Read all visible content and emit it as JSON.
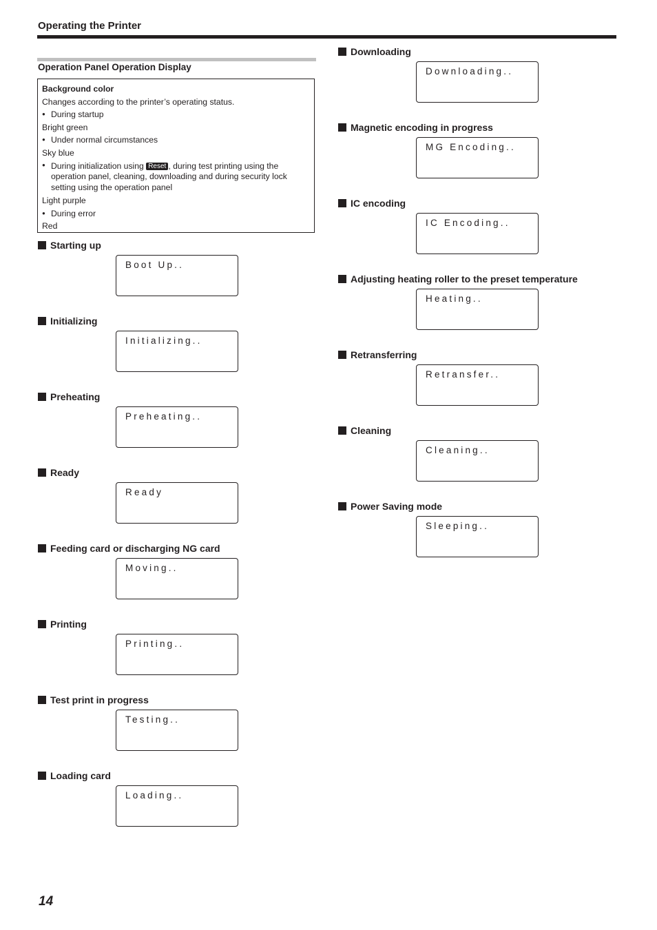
{
  "header": {
    "title": "Operating the Printer"
  },
  "section": {
    "title": "Operation Panel Operation Display"
  },
  "background_color_box": {
    "heading": "Background color",
    "intro": "Changes according to the printer’s operating status.",
    "entries": [
      {
        "condition": "During startup",
        "color": "Bright green"
      },
      {
        "condition": "Under normal circumstances",
        "color": "Sky blue"
      },
      {
        "condition_prefix": "During initialization using ",
        "key_label": "Reset",
        "condition_suffix": ", during test printing using the operation panel, cleaning, downloading and during security lock setting using the operation panel",
        "color": "Light purple"
      },
      {
        "condition": "During error",
        "color": "Red"
      }
    ]
  },
  "left_column": [
    {
      "heading": "Starting up",
      "display": "Boot Up.."
    },
    {
      "heading": "Initializing",
      "display": "Initializing.."
    },
    {
      "heading": "Preheating",
      "display": "Preheating.."
    },
    {
      "heading": "Ready",
      "display": "Ready"
    },
    {
      "heading": "Feeding card or discharging NG card",
      "display": "Moving.."
    },
    {
      "heading": "Printing",
      "display": "Printing.."
    },
    {
      "heading": "Test print in progress",
      "display": "Testing.."
    },
    {
      "heading": "Loading card",
      "display": "Loading.."
    }
  ],
  "right_column": [
    {
      "heading": "Downloading",
      "display": "Downloading.."
    },
    {
      "heading": "Magnetic encoding in progress",
      "display": "MG Encoding.."
    },
    {
      "heading": "IC encoding",
      "display": "IC Encoding.."
    },
    {
      "heading": "Adjusting heating roller to the preset temperature",
      "display": "Heating.."
    },
    {
      "heading": "Retransferring",
      "display": "Retransfer.."
    },
    {
      "heading": "Cleaning",
      "display": "Cleaning.."
    },
    {
      "heading": "Power Saving mode",
      "display": "Sleeping.."
    }
  ],
  "footer": {
    "page_number": "14"
  }
}
